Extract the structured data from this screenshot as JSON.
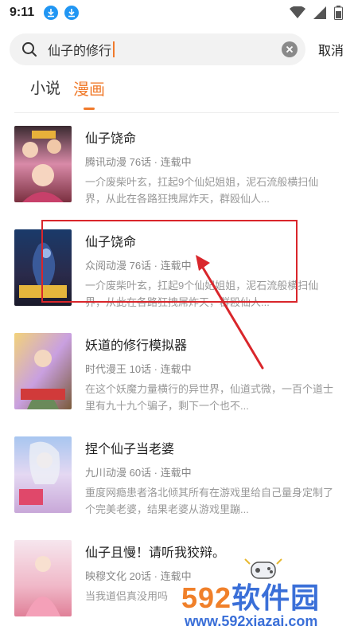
{
  "status_bar": {
    "time": "9:11",
    "icons": [
      "download-icon",
      "download-icon",
      "wifi-icon",
      "signal-icon",
      "battery-icon"
    ]
  },
  "search": {
    "query": "仙子的修行",
    "clear_icon": "clear-icon",
    "cancel_label": "取消"
  },
  "tabs": [
    {
      "label": "小说",
      "active": false
    },
    {
      "label": "漫画",
      "active": true
    }
  ],
  "colors": {
    "accent": "#f07a2b",
    "annotation": "#d9262b"
  },
  "results": [
    {
      "title": "仙子饶命",
      "meta": "腾讯动漫  76话 · 连载中",
      "description": "一介废柴叶玄，扛起9个仙妃姐姐，泥石流般横扫仙界，从此在各路狂拽屌炸天，群殴仙人..."
    },
    {
      "title": "仙子饶命",
      "meta": "众阅动漫  76话 · 连载中",
      "description": "一介废柴叶玄，扛起9个仙妃姐姐，泥石流般横扫仙界，从此在各路狂拽屌炸天，群殴仙人..."
    },
    {
      "title": "妖道的修行模拟器",
      "meta": "时代漫王  10话 · 连载中",
      "description": "在这个妖魔力量横行的异世界，仙道式微，一百个道士里有九十九个骗子，剩下一个也不..."
    },
    {
      "title": "捏个仙子当老婆",
      "meta": "九川动漫  60话 · 连载中",
      "description": "重度网瘾患者洛北倾其所有在游戏里给自己量身定制了个完美老婆，结果老婆从游戏里蹦..."
    },
    {
      "title": "仙子且慢！请听我狡辩。",
      "meta": "映穆文化  20话 · 连载中",
      "description": "当我道侣真没用吗"
    }
  ],
  "watermark": {
    "number": "592",
    "text": "软件园",
    "url": "www.592xiazai.com"
  }
}
